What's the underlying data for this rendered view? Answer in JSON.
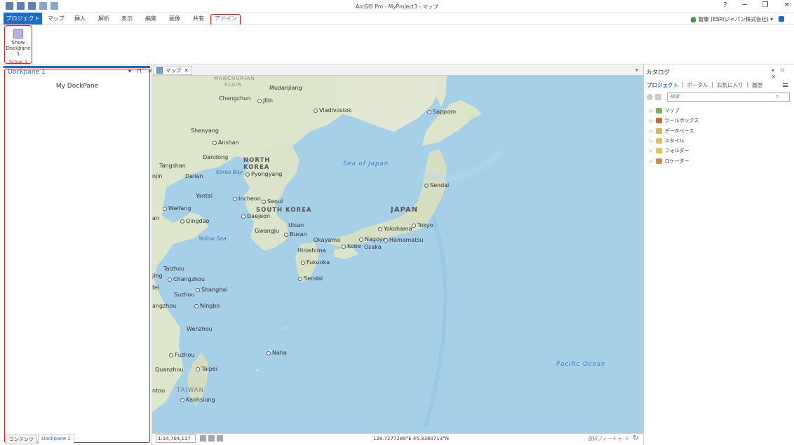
{
  "window": {
    "title": "ArcGIS Pro - MyProject3 - マップ",
    "help": "?",
    "minimize": "─",
    "restore": "❐",
    "close": "✕"
  },
  "tabs": [
    "プロジェクト",
    "マップ",
    "挿入",
    "解析",
    "表示",
    "編集",
    "画像",
    "共有",
    "アドイン"
  ],
  "user": {
    "name": "智康 (ESRIジャパン株式会社) ▾"
  },
  "ribbon": {
    "button_label_1": "Show",
    "button_label_2": "Dockpane 1",
    "group_label": "Group 1"
  },
  "dockpane": {
    "title": "Dockpane 1",
    "controls": "▾ ⊓ ✕",
    "content": "My DockPane",
    "bottom_tabs": [
      "コンテンツ",
      "Dockpane 1"
    ]
  },
  "map_view": {
    "tab_label": "マップ",
    "tab_close": "✕",
    "dropdown": "▾",
    "scale": "1:14,704,117",
    "coordinates": "128.7277289°E 45.3380713°N",
    "selected_features": "選択フィーチャ: 0",
    "labels": {
      "manchurian": "MANCHURIAN",
      "plain": "PLAIN",
      "changchun": "Changchun",
      "mudanjiang": "Mudanjiang",
      "jilin": "Jilin",
      "vladivostok": "Vladivostok",
      "sapporo": "Sapporo",
      "shenyang": "Shenyang",
      "anshan": "Anshan",
      "dandong": "Dandong",
      "north": "NORTH",
      "korea": "KOREA",
      "tangshan": "Tangshan",
      "korea_bay": "Korea Bay",
      "pyongyang": "Pyongyang",
      "sea_of_japan": "Sea of Japan",
      "sendai_n": "Sendai",
      "tianjin": "njin",
      "dalian": "Dalian",
      "yantai": "Yantai",
      "incheon": "Incheon",
      "seoul": "Seoul",
      "weifang": "Weifang",
      "south_korea": "SOUTH KOREA",
      "japan": "JAPAN",
      "daejeon": "Daejeon",
      "qingdao": "Qingdao",
      "an": "an",
      "ulsan": "Ulsan",
      "yokohama": "Yokohama",
      "tokyo": "Tokyo",
      "gwangju": "Gwangju",
      "busan": "Busan",
      "yellow_sea": "Yellow Sea",
      "okayama": "Okayama",
      "nagoya": "Nagoya",
      "hamamatsu": "Hamamatsu",
      "kobe": "Kobe",
      "osaka": "Osaka",
      "hiroshima": "Hiroshima",
      "fukuoka": "Fukuoka",
      "taizhou": "Taizhou",
      "jing": "jing",
      "changzhou": "Changzhou",
      "fei": "fei",
      "shanghai": "Shanghai",
      "sendai_s": "Sendai",
      "suzhou": "Suzhou",
      "hangzhou": "angzhou",
      "ningbo": "Ningbo",
      "wenzhou": "Wenzhou",
      "naha": "Naha",
      "fuzhou": "Fuzhou",
      "quanzhou": "Quanzhou",
      "taipei": "Taipei",
      "pacific": "Pacific Ocean",
      "taiwan": "TAIWAN",
      "ntou": "ntou",
      "kaohsiung": "Kaohsiung"
    }
  },
  "catalog": {
    "title": "カタログ",
    "controls": "▾ ⊓ ✕",
    "tabs": [
      "プロジェクト",
      "|",
      "ポータル",
      "|",
      "お気に入り",
      "|",
      "履歴"
    ],
    "search_placeholder": "検索",
    "items": [
      "マップ",
      "ツールボックス",
      "データベース",
      "スタイル",
      "フォルダー",
      "ロケーター"
    ]
  },
  "colors": {
    "accent": "#1e6bc5",
    "highlight": "#e21b1b",
    "sea": "#a6cfe8",
    "land": "#dfe6cf"
  }
}
